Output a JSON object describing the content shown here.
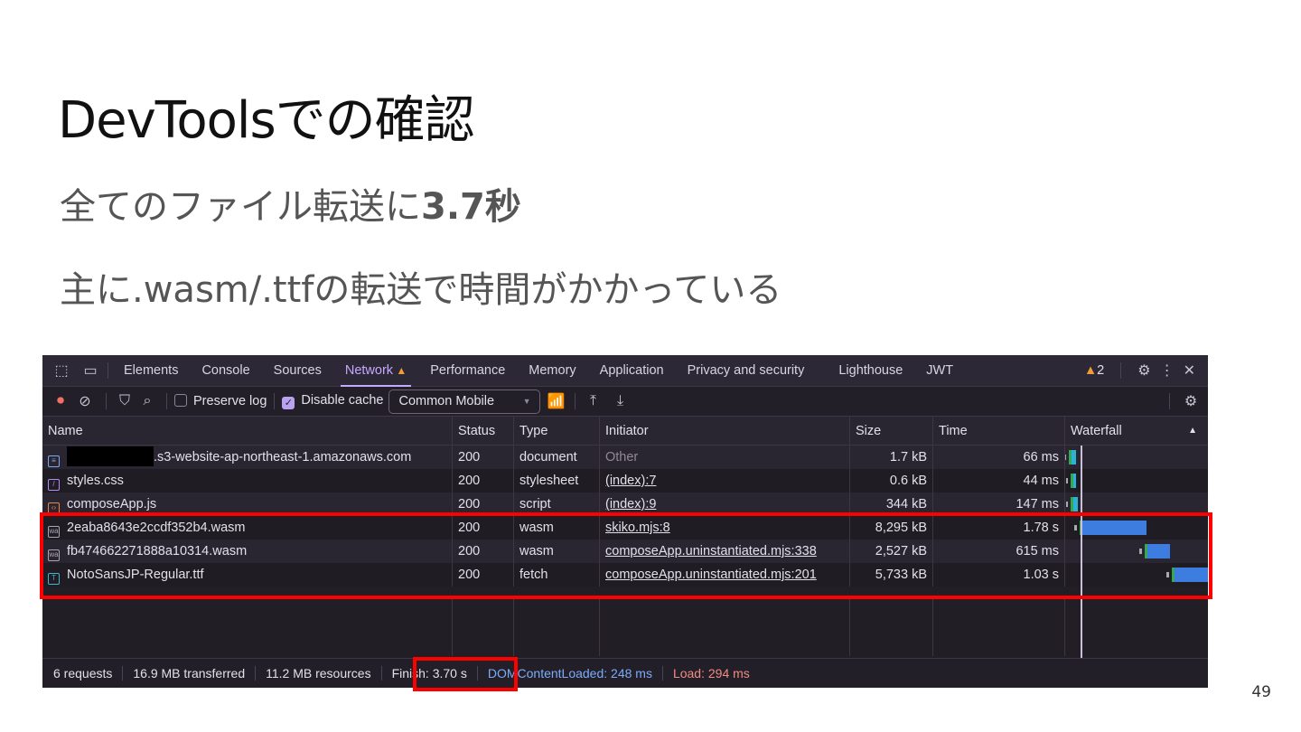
{
  "slide": {
    "title": "DevToolsでの確認",
    "line1_prefix": "全てのファイル転送に",
    "line1_bold": "3.7秒",
    "line2": "主に.wasm/.ttfの転送で時間がかかっている",
    "page_number": "49"
  },
  "devtools": {
    "tabs": [
      "Elements",
      "Console",
      "Sources",
      "Network",
      "Performance",
      "Memory",
      "Application",
      "Privacy and security",
      "Lighthouse",
      "JWT"
    ],
    "active_tab": "Network",
    "warning_count": "2",
    "toolbar": {
      "preserve_log": "Preserve log",
      "preserve_log_checked": false,
      "disable_cache": "Disable cache",
      "disable_cache_checked": true,
      "throttling": "Common Mobile"
    },
    "columns": [
      "Name",
      "Status",
      "Type",
      "Initiator",
      "Size",
      "Time",
      "Waterfall"
    ],
    "rows": [
      {
        "name": ".s3-website-ap-northeast-1.amazonaws.com",
        "redacted": true,
        "icon": "document-icon",
        "status": "200",
        "type": "document",
        "initiator": "Other",
        "size": "1.7 kB",
        "time": "66 ms"
      },
      {
        "name": "styles.css",
        "icon": "stylesheet-icon",
        "status": "200",
        "type": "stylesheet",
        "initiator": "(index):7",
        "size": "0.6 kB",
        "time": "44 ms"
      },
      {
        "name": "composeApp.js",
        "icon": "script-icon",
        "status": "200",
        "type": "script",
        "initiator": "(index):9",
        "size": "344 kB",
        "time": "147 ms"
      },
      {
        "name": "2eaba8643e2ccdf352b4.wasm",
        "icon": "wasm-icon",
        "status": "200",
        "type": "wasm",
        "initiator": "skiko.mjs:8",
        "size": "8,295 kB",
        "time": "1.78 s"
      },
      {
        "name": "fb474662271888a10314.wasm",
        "icon": "wasm-icon",
        "status": "200",
        "type": "wasm",
        "initiator": "composeApp.uninstantiated.mjs:338",
        "size": "2,527 kB",
        "time": "615 ms"
      },
      {
        "name": "NotoSansJP-Regular.ttf",
        "icon": "font-icon",
        "status": "200",
        "type": "fetch",
        "initiator": "composeApp.uninstantiated.mjs:201",
        "size": "5,733 kB",
        "time": "1.03 s"
      }
    ],
    "summary": {
      "requests": "6 requests",
      "transferred": "16.9 MB transferred",
      "resources": "11.2 MB resources",
      "finish": "Finish: 3.70 s",
      "dom": "DOMContentLoaded: 248 ms",
      "load": "Load: 294 ms"
    },
    "colors": {
      "highlight": "#ff0000",
      "dom": "#7cacf8",
      "load": "#f28b82",
      "accent": "#c5a8ff"
    }
  }
}
